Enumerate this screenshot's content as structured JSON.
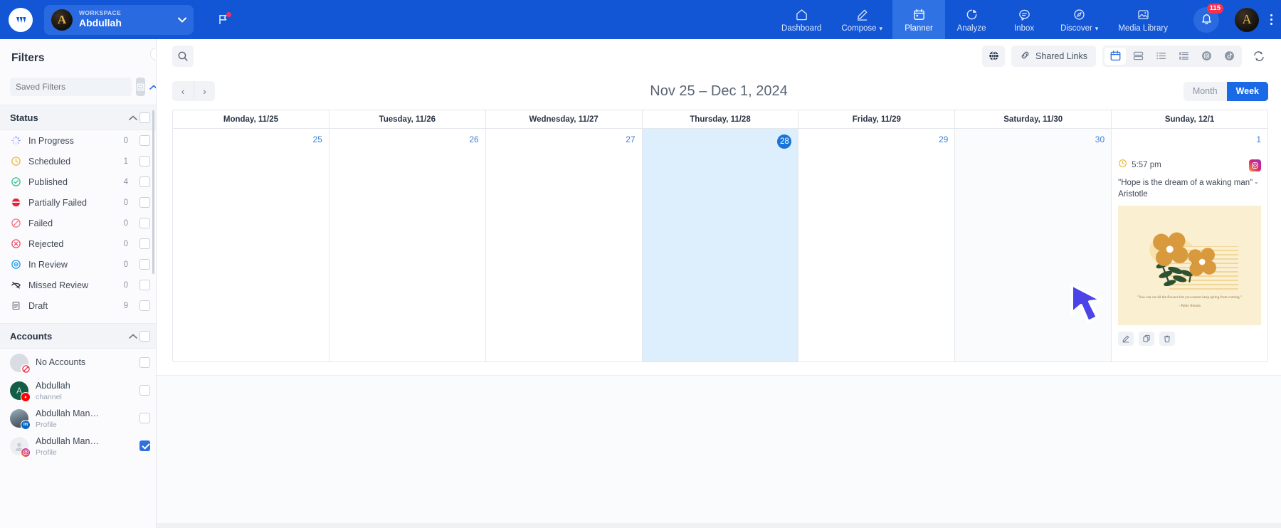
{
  "topnav": {
    "logo": "app-logo",
    "workspace": {
      "label": "WORKSPACE",
      "name": "Abdullah",
      "avatar_letter": "A",
      "caret": "⌄"
    },
    "flag_icon": "flag-icon",
    "items": [
      {
        "id": "dashboard",
        "label": "Dashboard",
        "icon": "home-icon",
        "active": false,
        "caret": ""
      },
      {
        "id": "compose",
        "label": "Compose",
        "icon": "pencil-icon",
        "active": false,
        "caret": "⌄"
      },
      {
        "id": "planner",
        "label": "Planner",
        "icon": "calendar-icon",
        "active": true,
        "caret": ""
      },
      {
        "id": "analyze",
        "label": "Analyze",
        "icon": "pie-chart-icon",
        "active": false,
        "caret": ""
      },
      {
        "id": "inbox",
        "label": "Inbox",
        "icon": "chat-icon",
        "active": false,
        "caret": ""
      },
      {
        "id": "discover",
        "label": "Discover",
        "icon": "compass-icon",
        "active": false,
        "caret": "⌄"
      },
      {
        "id": "media-library",
        "label": "Media Library",
        "icon": "image-stack-icon",
        "active": false,
        "caret": ""
      }
    ],
    "notifications_count": "115",
    "user_avatar_letter": "A",
    "accent_blue": "#1256d6",
    "active_blue": "#2e72e3",
    "badge_red": "#f4314f"
  },
  "sidebar": {
    "title": "Filters",
    "saved_filters_placeholder": "Saved Filters",
    "status_section": {
      "label": "Status"
    },
    "status_items": [
      {
        "label": "In Progress",
        "count": "0",
        "icon": "spinner-icon",
        "color": "#7b85f0"
      },
      {
        "label": "Scheduled",
        "count": "1",
        "icon": "clock-icon",
        "color": "#f0b840"
      },
      {
        "label": "Published",
        "count": "4",
        "icon": "check-circle-icon",
        "color": "#3bbf8c"
      },
      {
        "label": "Partially Failed",
        "count": "0",
        "icon": "half-circle-icon",
        "color": "#e8243c"
      },
      {
        "label": "Failed",
        "count": "0",
        "icon": "slash-circle-icon",
        "color": "#f2788a"
      },
      {
        "label": "Rejected",
        "count": "0",
        "icon": "x-circle-icon",
        "color": "#f2526b"
      },
      {
        "label": "In Review",
        "count": "0",
        "icon": "eye-icon",
        "color": "#1c9be8"
      },
      {
        "label": "Missed Review",
        "count": "0",
        "icon": "eye-off-icon",
        "color": "#2b3546"
      },
      {
        "label": "Draft",
        "count": "9",
        "icon": "clipboard-icon",
        "color": "#6d7787"
      }
    ],
    "accounts_section": {
      "label": "Accounts"
    },
    "accounts": [
      {
        "name": "No Accounts",
        "sub": "",
        "platform": "none",
        "checked": false,
        "avatar_color": "#d9dde3",
        "letter": ""
      },
      {
        "name": "Abdullah",
        "sub": "channel",
        "platform": "youtube",
        "checked": false,
        "avatar_color": "#135c45",
        "letter": "A"
      },
      {
        "name": "Abdullah Man…",
        "sub": "Profile",
        "platform": "linkedin",
        "checked": false,
        "avatar_color": "#7f8c9b",
        "letter": ""
      },
      {
        "name": "Abdullah Man…",
        "sub": "Profile",
        "platform": "instagram",
        "checked": true,
        "avatar_color": "#eceef2",
        "letter": ""
      }
    ]
  },
  "toolbar": {
    "search_icon": "search-icon",
    "globe_icon": "globe-icon",
    "shared_links_label": "Shared Links",
    "shared_links_icon": "link-icon",
    "views": [
      {
        "id": "calendar",
        "icon": "calendar-view-icon",
        "active": true
      },
      {
        "id": "rows",
        "icon": "rows-view-icon",
        "active": false
      },
      {
        "id": "list",
        "icon": "list-view-icon",
        "active": false
      },
      {
        "id": "feed",
        "icon": "feed-view-icon",
        "active": false
      },
      {
        "id": "instagram",
        "icon": "instagram-icon",
        "active": false
      },
      {
        "id": "tiktok",
        "icon": "tiktok-icon",
        "active": false
      }
    ],
    "refresh_icon": "refresh-icon"
  },
  "datebar": {
    "prev_label": "‹",
    "next_label": "›",
    "range_title": "Nov 25 – Dec 1, 2024",
    "month_label": "Month",
    "week_label": "Week",
    "active_view": "Week"
  },
  "calendar": {
    "days": [
      {
        "header": "Monday, 11/25",
        "num": "25",
        "today": false,
        "weekend": false
      },
      {
        "header": "Tuesday, 11/26",
        "num": "26",
        "today": false,
        "weekend": false
      },
      {
        "header": "Wednesday, 11/27",
        "num": "27",
        "today": false,
        "weekend": false
      },
      {
        "header": "Thursday, 11/28",
        "num": "28",
        "today": true,
        "weekend": false
      },
      {
        "header": "Friday, 11/29",
        "num": "29",
        "today": false,
        "weekend": false
      },
      {
        "header": "Saturday, 11/30",
        "num": "30",
        "today": false,
        "weekend": true
      },
      {
        "header": "Sunday, 12/1",
        "num": "1",
        "today": false,
        "weekend": false
      }
    ],
    "post": {
      "day_index": 6,
      "time": "5:57 pm",
      "status_icon": "clock-icon",
      "platform": "instagram",
      "text": "\"Hope is the dream of a waking man\" - Aristotle",
      "image_quote": "\"You can cut all the flowers but you cannot keep spring from coming.\"",
      "image_author": "- Pablo Neruda",
      "actions": [
        {
          "id": "edit",
          "icon": "pencil-icon"
        },
        {
          "id": "duplicate",
          "icon": "copy-icon"
        },
        {
          "id": "delete",
          "icon": "trash-icon"
        }
      ]
    }
  }
}
